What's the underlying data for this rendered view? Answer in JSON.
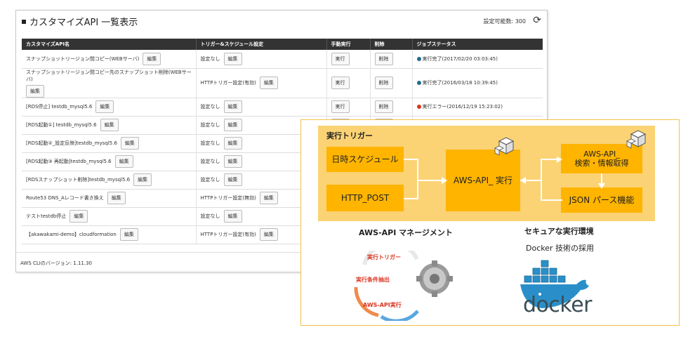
{
  "app": {
    "title": "カスタマイズAPI 一覧表示",
    "capacity": "設定可能数: 300",
    "version": "AWS CLIのバージョン: 1.11.30"
  },
  "table": {
    "headers": [
      "カスタマイズAPI名",
      "トリガー&スケジュール設定",
      "手動実行",
      "削除",
      "ジョブステータス"
    ],
    "rows": [
      {
        "name": "スナップショットリージョン間コピー(WEBサーバ)",
        "trigger": "設定なし",
        "status": "実行完了(2017/02/20 03:03:45)",
        "state": "ok"
      },
      {
        "name": "スナップショットリージョン間コピー先のスナップショット削除(WEBサーバ)",
        "trigger": "HTTPトリガー設定(有効)",
        "status": "実行完了(2016/03/18 10:39:45)",
        "state": "ok"
      },
      {
        "name": "[RDS停止] testdb_mysql5.6",
        "trigger": "設定なし",
        "status": "実行エラー(2016/12/19 15:23:02)",
        "state": "err"
      },
      {
        "name": "[RDS起動①] testdb_mysql5.6",
        "trigger": "設定なし",
        "status": "",
        "state": "err"
      },
      {
        "name": "[RDS起動②_設定反映]testdb_mysql5.6",
        "trigger": "設定なし",
        "status": "",
        "state": ""
      },
      {
        "name": "[RDS起動③ 再起動]testdb_mysql5.6",
        "trigger": "設定なし",
        "status": "",
        "state": ""
      },
      {
        "name": "[RDSスナップショット削除]testdb_mysql5.6",
        "trigger": "設定なし",
        "status": "",
        "state": ""
      },
      {
        "name": "Route53 DNS_Aレコード書き換え",
        "trigger": "HTTPトリガー設定(無効)",
        "status": "",
        "state": ""
      },
      {
        "name": "テストtestdb停止",
        "trigger": "設定なし",
        "status": "",
        "state": ""
      },
      {
        "name": "【akawakami-demo】cloudformation",
        "trigger": "HTTPトリガー設定(有効)",
        "status": "",
        "state": ""
      }
    ],
    "edit_label": "編集",
    "run_label": "実行",
    "delete_label": "削除"
  },
  "overlay": {
    "trigger_title": "実行トリガー",
    "schedule": "日時スケジュール",
    "http_post": "HTTP_POST",
    "center": "AWS-API_ 実行",
    "fetch_line1": "AWS-API_",
    "fetch_line2": "検索・情報取得",
    "json": "JSON パース機能",
    "mgmt_title": "AWS-API マネージメント",
    "secure_title": "セキュアな実行環境",
    "docker_sub": "Docker 技術の採用",
    "cycle_labels": [
      "実行トリガー",
      "実行条件抽出",
      "AWS-API実行"
    ],
    "docker_word": "docker"
  },
  "colors": {
    "header_bg": "#333333",
    "box_orange": "#ffb400",
    "area_yellow": "#fbd374",
    "ok_dot": "#1e6e8c",
    "err_dot": "#d9341f"
  }
}
